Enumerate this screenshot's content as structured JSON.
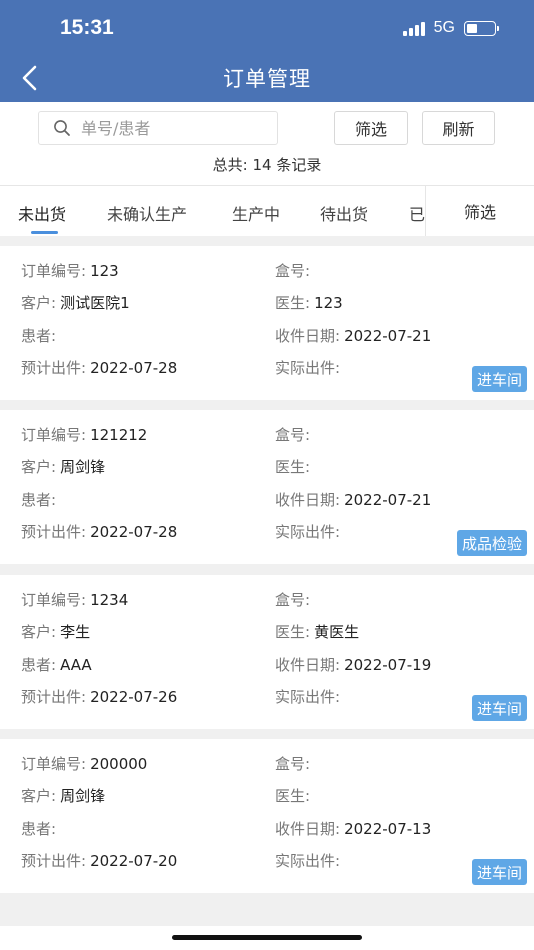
{
  "status_bar": {
    "time": "15:31",
    "network": "5G"
  },
  "header": {
    "title": "订单管理"
  },
  "search": {
    "placeholder": "单号/患者",
    "filter_label": "筛选",
    "refresh_label": "刷新"
  },
  "summary": {
    "text": "总共: 14 条记录"
  },
  "tabs": {
    "items": [
      {
        "label": "未出货"
      },
      {
        "label": "未确认生产"
      },
      {
        "label": "生产中"
      },
      {
        "label": "待出货"
      },
      {
        "label": "已"
      }
    ],
    "active_index": 0,
    "filter_label": "筛选"
  },
  "labels": {
    "order_no": "订单编号:",
    "box_no": "盒号:",
    "customer": "客户:",
    "doctor": "医生:",
    "patient": "患者:",
    "received_date": "收件日期:",
    "expected_ship": "预计出件:",
    "actual_ship": "实际出件:"
  },
  "orders": [
    {
      "order_no": "123",
      "box_no": "",
      "customer": "测试医院1",
      "doctor": "123",
      "patient": "",
      "received_date": "2022-07-21",
      "expected_ship": "2022-07-28",
      "actual_ship": "",
      "status": "进车间"
    },
    {
      "order_no": "121212",
      "box_no": "",
      "customer": "周剑锋",
      "doctor": "",
      "patient": "",
      "received_date": "2022-07-21",
      "expected_ship": "2022-07-28",
      "actual_ship": "",
      "status": "成品检验"
    },
    {
      "order_no": "1234",
      "box_no": "",
      "customer": "李生",
      "doctor": "黄医生",
      "patient": "AAA",
      "received_date": "2022-07-19",
      "expected_ship": "2022-07-26",
      "actual_ship": "",
      "status": "进车间"
    },
    {
      "order_no": "200000",
      "box_no": "",
      "customer": "周剑锋",
      "doctor": "",
      "patient": "",
      "received_date": "2022-07-13",
      "expected_ship": "2022-07-20",
      "actual_ship": "",
      "status": "进车间"
    }
  ],
  "colors": {
    "header_bg": "#4a73b5",
    "accent": "#4a8fdd",
    "badge_bg": "#5fa7e6"
  }
}
